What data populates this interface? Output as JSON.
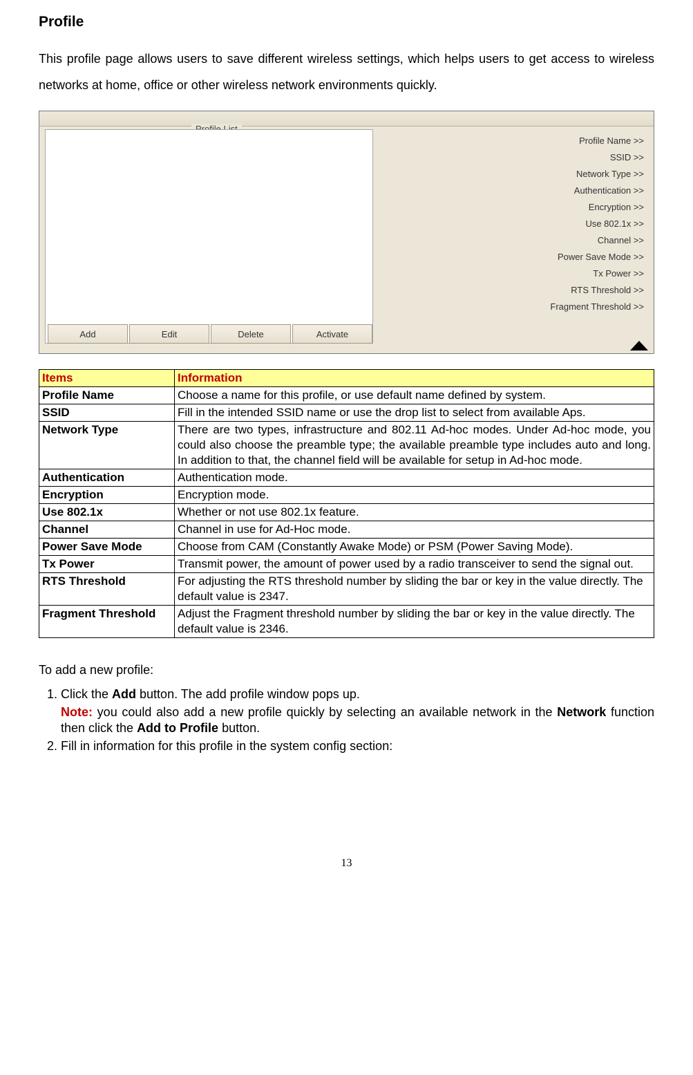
{
  "title": "Profile",
  "intro": "This profile page allows users to save different wireless settings, which helps users to get access to wireless networks at home, office or other wireless network environments quickly.",
  "shot": {
    "legend": "Profile List",
    "buttons": {
      "add": "Add",
      "edit": "Edit",
      "delete": "Delete",
      "activate": "Activate"
    },
    "details": [
      "Profile Name >>",
      "SSID >>",
      "Network Type >>",
      "Authentication >>",
      "Encryption >>",
      "Use 802.1x >>",
      "Channel >>",
      "Power Save Mode >>",
      "Tx Power >>",
      "RTS Threshold >>",
      "Fragment Threshold >>"
    ]
  },
  "table": {
    "head_items": "Items",
    "head_info": "Information",
    "rows": [
      {
        "k": "Profile Name",
        "v": "Choose a name for this profile, or use default name defined by system."
      },
      {
        "k": "SSID",
        "v": "Fill in the intended SSID name or use the drop list to select from available Aps."
      },
      {
        "k": "Network Type",
        "v": "There are two types, infrastructure and 802.11 Ad-hoc modes. Under Ad-hoc mode, you could also choose the preamble type; the available preamble type includes auto and long. In addition to that, the channel field will be available for setup in Ad-hoc mode.",
        "justify": true
      },
      {
        "k": "Authentication",
        "v": "Authentication mode."
      },
      {
        "k": "Encryption",
        "v": "Encryption mode."
      },
      {
        "k": "Use 802.1x",
        "v": "Whether or not use 802.1x feature."
      },
      {
        "k": "Channel",
        "v": "Channel in use for Ad-Hoc mode."
      },
      {
        "k": "Power Save Mode",
        "v": "Choose from CAM (Constantly Awake Mode) or PSM (Power Saving Mode).",
        "justify": true
      },
      {
        "k": "Tx Power",
        "v": "Transmit power, the amount of power used by a radio transceiver to send the signal out."
      },
      {
        "k": "RTS Threshold",
        "v": "For adjusting the RTS threshold number by sliding the bar or key in the value directly. The default value is 2347."
      },
      {
        "k": "Fragment Threshold",
        "v": "Adjust the Fragment threshold number by sliding the bar or key in the value directly. The default value is 2346."
      }
    ]
  },
  "subhead": "To add a new profile:",
  "step1_a": "Click the ",
  "step1_b": "Add",
  "step1_c": " button. The add profile window pops up.",
  "note_label": "Note:",
  "note_a": " you could also add a new profile quickly by selecting an available network in the ",
  "note_b": "Network",
  "note_c": " function then click the ",
  "note_d": "Add to Profile",
  "note_e": " button.",
  "step2": "Fill in information for this profile in the system config section:",
  "pagenum": "13"
}
